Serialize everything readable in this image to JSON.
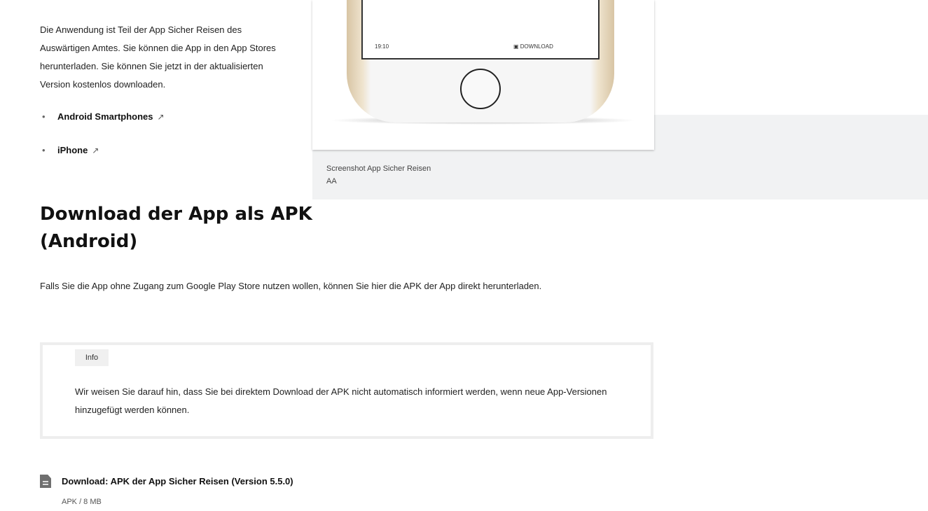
{
  "intro_text": "Die Anwendung ist Teil der App Sicher Reisen des Auswärtigen Amtes. Sie können die App in den App Stores herunterladen. Sie können Sie jetzt in der aktualisierten Version kostenlos downloaden.",
  "stores": [
    {
      "label": "Android Smartphones",
      "icon": "external-link-icon"
    },
    {
      "label": "iPhone",
      "icon": "external-link-icon"
    }
  ],
  "figure": {
    "screen_left": "19:10",
    "screen_right": "DOWNLOAD",
    "caption": "Screenshot App Sicher Reisen",
    "caption_source": "AA"
  },
  "section": {
    "title": "Download der App als APK (Android)",
    "text": "Falls Sie die App ohne Zugang zum Google Play Store nutzen wollen, können Sie hier die APK der App direkt herunterladen."
  },
  "info": {
    "label": "Info",
    "text": "Wir weisen Sie darauf hin, dass Sie bei direktem Download der APK nicht automatisch informiert werden, wenn neue App-Versionen hinzugefügt werden können."
  },
  "download": {
    "link": "Download: APK der App Sicher Reisen (Version 5.5.0)",
    "meta": "APK / 8 MB",
    "icon": "file-icon"
  }
}
